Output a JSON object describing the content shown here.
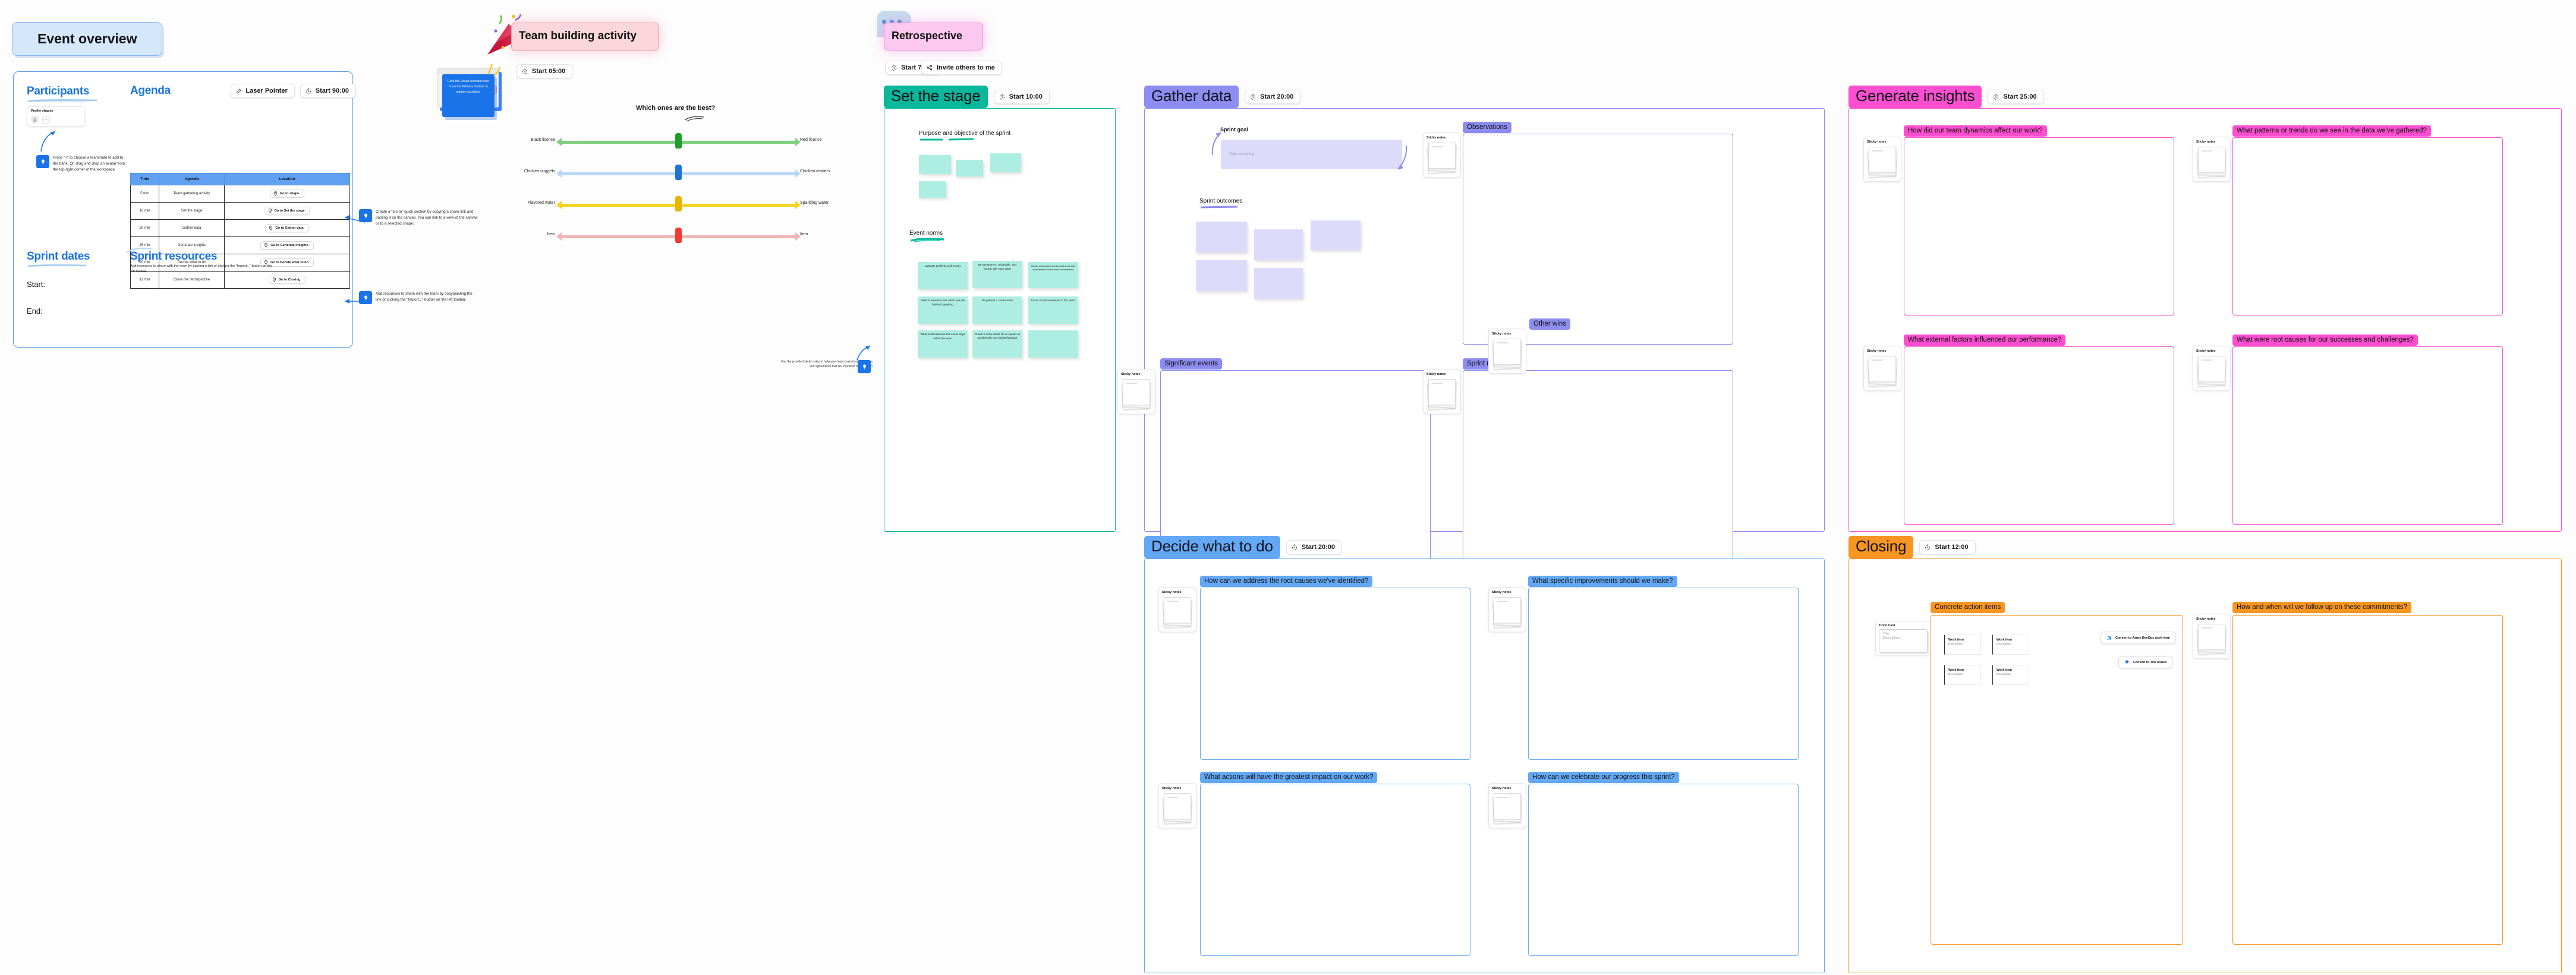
{
  "event_overview": {
    "title": "Event overview",
    "participants": {
      "heading": "Participants",
      "profile_shapes_label": "Profile shapes",
      "add_icon": "plus-icon",
      "avatar_icon": "person-icon",
      "tip": "Press \"+\" to choose a teammate to add to the bank. Or, drag and drop an avatar from the top-right corner of the workspace."
    },
    "agenda": {
      "heading": "Agenda",
      "laser_pointer_label": "Laser Pointer",
      "start_timer_label": "Start 90:00",
      "columns": [
        "Time",
        "Agenda",
        "Location"
      ],
      "rows": [
        {
          "time": "5 min",
          "agenda": "Team gathering activity",
          "location": "Go to shape"
        },
        {
          "time": "10 min",
          "agenda": "Set the stage",
          "location": "Go to Set the stage"
        },
        {
          "time": "20 min",
          "agenda": "Gather data",
          "location": "Go to Gather data"
        },
        {
          "time": "25 min",
          "agenda": "Generate insights",
          "location": "Go to Generate insights"
        },
        {
          "time": "20 min",
          "agenda": "Decide what to do",
          "location": "Go to Decide what to do"
        },
        {
          "time": "12 min",
          "agenda": "Close the retrospective",
          "location": "Go to Closing"
        }
      ]
    },
    "sprint_dates": {
      "heading": "Sprint dates",
      "start_label": "Start:",
      "end_label": "End:"
    },
    "sprint_resources": {
      "heading": "Sprint resources",
      "description": "Add resources to share with the team by pasting a link or clicking the \"Import...\" button on the left toolbar."
    },
    "tips": {
      "goto_tip": "Create a \"Go to\" quick section by copying a share link and pasting it on the canvas. You can link to a view of the canvas or to a selected shape.",
      "resources_tip": "Add resources to share with the team by copy/pasting the link or clicking the \"Import...\" button on the left toolbar."
    }
  },
  "team_building": {
    "title": "Team building activity",
    "start_timer_label": "Start 05:00",
    "tip": "Click the Visual Activities icon ✂ on the Primary Toolbar to explore activities.",
    "preview_chip_label": "Team building activity"
  },
  "chart_data": {
    "type": "bar",
    "title": "Which ones are the best?",
    "xlabel": "",
    "ylabel": "",
    "orientation": "horizontal-slider",
    "categories": [
      "Black licorice / Red licorice",
      "Chicken nuggets / Chicken tenders",
      "Flavored water / Sparkling water",
      "Item / Item"
    ],
    "values": [
      50,
      50,
      50,
      50
    ],
    "xlim": [
      0,
      100
    ],
    "grid": false,
    "legend": false,
    "series": [
      {
        "name": "slider position (%)",
        "values": [
          50,
          50,
          50,
          50
        ]
      }
    ],
    "rows": [
      {
        "left_label": "Black licorice",
        "right_label": "Red licorice",
        "value": 50,
        "color": "#7ed07e"
      },
      {
        "left_label": "Chicken nuggets",
        "right_label": "Chicken tenders",
        "value": 50,
        "color": "#9ec5f5"
      },
      {
        "left_label": "Flavored water",
        "right_label": "Sparkling water",
        "value": 50,
        "color": "#f5d321"
      },
      {
        "left_label": "Item",
        "right_label": "Item",
        "value": 50,
        "color": "#f3b4b4"
      }
    ],
    "knob_colors": [
      "#1f9e2e",
      "#1f72d6",
      "#e8b400",
      "#f33b33"
    ]
  },
  "retrospective": {
    "title": "Retrospective",
    "start_timer_label": "Start 75:00",
    "invite_label": "Invite others to me"
  },
  "set_the_stage": {
    "tag": "Set the stage",
    "tag_color": "#09b89a",
    "start_timer_label": "Start 10:00",
    "purpose_heading": "Purpose and objective of the sprint",
    "event_norms_heading": "Event norms",
    "norms_tip": "Use the provided sticky notes to help your team brainstorm the norms and agreements that are important to your team",
    "notes": [
      "Cultivate positivity and energy",
      "Be transparent, vulnerable, and honest with each other",
      "Identify actionable commitments and create work items to honor those commitments",
      "Pass to someone else when you are finished speaking",
      "Be positive + constructive",
      "Focus on items relevant to the sprint",
      "What is discussed in this event stays within the team",
      "Growth is in the details. Be as specific as possible with your insights/feedback",
      ""
    ]
  },
  "gather_data": {
    "tag": "Gather data",
    "tag_color": "#8d8cf0",
    "start_timer_label": "Start 20:00",
    "sprint_goal_heading": "Sprint goal",
    "sprint_goal_placeholder": "Type something",
    "sprint_outcomes_heading": "Sprint outcomes",
    "sticky_notes_label": "Sticky notes",
    "sections": [
      {
        "label": "Observations"
      },
      {
        "label": "Significant events"
      },
      {
        "label": "Sprint metrics"
      },
      {
        "label": "Other wins"
      }
    ]
  },
  "generate_insights": {
    "tag": "Generate insights",
    "tag_color": "#fc4fd0",
    "start_timer_label": "Start 25:00",
    "sticky_notes_label": "Sticky notes",
    "questions": [
      "How did our team dynamics affect our work?",
      "What patterns or trends do we see in the data we've gathered?",
      "What external factors influenced our performance?",
      "What were root causes for our successes and challenges?"
    ]
  },
  "decide_what_to_do": {
    "tag": "Decide what to do",
    "tag_color": "#63a8f5",
    "start_timer_label": "Start 20:00",
    "sticky_notes_label": "Sticky notes",
    "questions": [
      "How can we address the root causes we've identified?",
      "What specific improvements should we make?",
      "What actions will have the greatest impact on our work?",
      "How can we celebrate our progress this sprint?"
    ]
  },
  "closing": {
    "tag": "Closing",
    "tag_color": "#f79522",
    "start_timer_label": "Start 12:00",
    "sticky_notes_label": "Sticky notes",
    "ticket_card": {
      "label": "Ticket Card",
      "title_placeholder": "Title",
      "description_placeholder": "Description"
    },
    "sections": [
      {
        "label": "Concrete action items"
      },
      {
        "label": "How and when will we follow up on these commitments?"
      }
    ],
    "work_items": [
      {
        "title": "Work item",
        "description": "Description"
      },
      {
        "title": "Work item",
        "description": "Description"
      },
      {
        "title": "Work item",
        "description": "Description"
      },
      {
        "title": "Work item",
        "description": "Description"
      }
    ],
    "convert_buttons": [
      {
        "label": "Convert to Azure DevOps work item",
        "icon": "azure-devops-icon"
      },
      {
        "label": "Convert to Jira issues",
        "icon": "jira-icon"
      }
    ]
  }
}
